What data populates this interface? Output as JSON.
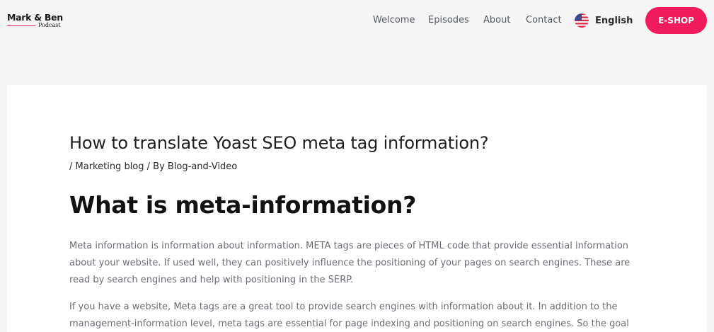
{
  "logo": {
    "title": "Mark & Ben",
    "subtitle": "Podcast",
    "accent_color": "#e8175d"
  },
  "nav": {
    "items": [
      {
        "label": "Welcome"
      },
      {
        "label": "Episodes"
      },
      {
        "label": "About"
      },
      {
        "label": "Contact"
      }
    ],
    "language": {
      "label": "English",
      "icon": "us-flag-icon"
    },
    "cta": {
      "label": "E-SHOP",
      "color": "#ef1b5d"
    }
  },
  "article": {
    "title": "How to translate Yoast SEO meta tag information?",
    "meta": {
      "prefix": "/ ",
      "category": "Marketing blog",
      "separator": " / By ",
      "author": "Blog-and-Video"
    },
    "heading": "What is meta-information?",
    "paragraphs": [
      [
        "Meta information is information about information. META tags are pieces of HTML code that provide essential information",
        "about your website. If used well, they can positively influence the positioning of your pages on search engines. These are",
        "read by search engines and help with positioning in the SERP."
      ],
      [
        "If you have a website, Meta tags are a great tool to provide search engines with information about it. In addition to the",
        "management-information level, meta tags are essential for page indexing and positioning on search engines. So the goal"
      ]
    ]
  }
}
